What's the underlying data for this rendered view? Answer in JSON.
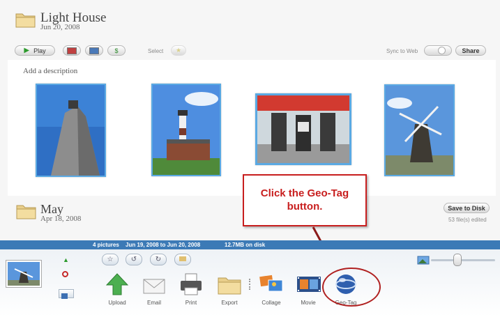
{
  "album1": {
    "title": "Light House",
    "date": "Jun 20, 2008",
    "description_placeholder": "Add a description"
  },
  "album1_toolbar": {
    "play_label": "Play",
    "select_label": "Select",
    "sync_label": "Sync to Web",
    "share_label": "Share"
  },
  "album2": {
    "title": "May",
    "date": "Apr 18, 2008",
    "save_label": "Save to Disk",
    "edited_note": "53 file(s) edited"
  },
  "callout": {
    "line1": "Click the Geo-Tag",
    "line2": "button."
  },
  "status": {
    "pictures": "4 pictures",
    "range": "Jun 19, 2008 to Jun 20, 2008",
    "size": "12.7MB on disk"
  },
  "tools": [
    {
      "label": "Upload"
    },
    {
      "label": "Email"
    },
    {
      "label": "Print"
    },
    {
      "label": "Export"
    },
    {
      "label": "Collage"
    },
    {
      "label": "Movie"
    },
    {
      "label": "Geo-Tag"
    }
  ],
  "colors": {
    "callout": "#c81e1e",
    "statusbar": "#3c7ab6",
    "thumb_border": "#5aa9e3"
  },
  "icons": [
    "folder-icon",
    "play-icon",
    "star-icon",
    "rotate-left-icon",
    "rotate-right-icon",
    "upload-icon",
    "email-icon",
    "print-icon",
    "export-folder-icon",
    "collage-icon",
    "movie-icon",
    "geotag-globe-icon",
    "landscape-size-icon"
  ]
}
